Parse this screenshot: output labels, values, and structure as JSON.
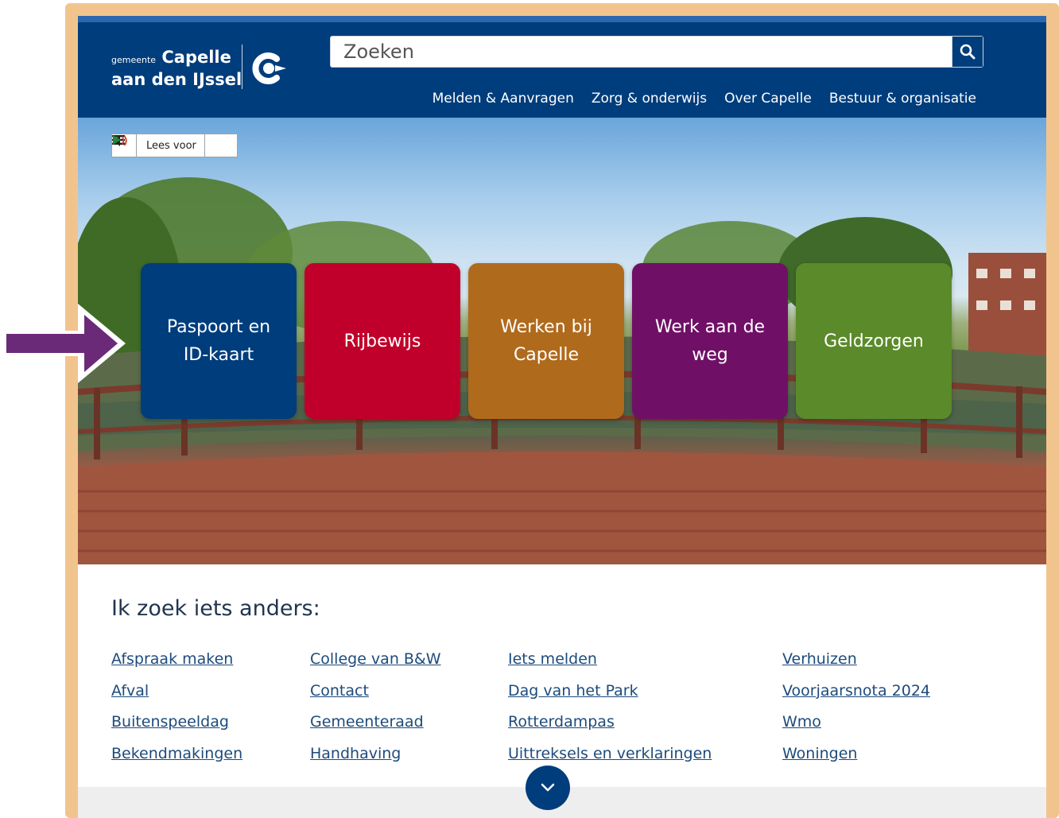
{
  "header": {
    "logo_line1_small": "gemeente",
    "logo_line1_big": "Capelle",
    "logo_line2": "aan den IJssel",
    "search_placeholder": "Zoeken",
    "nav": [
      "Melden & Aanvragen",
      "Zorg & onderwijs",
      "Over Capelle",
      "Bestuur & organisatie"
    ]
  },
  "readaloud": {
    "label": "Lees voor"
  },
  "tiles": [
    {
      "label": "Paspoort en ID-kaart",
      "color": "#003d7c"
    },
    {
      "label": "Rijbewijs",
      "color": "#c0002a"
    },
    {
      "label": "Werken bij Capelle",
      "color": "#b06a1c"
    },
    {
      "label": "Werk aan de weg",
      "color": "#6f1066"
    },
    {
      "label": "Geldzorgen",
      "color": "#5b8a2a"
    }
  ],
  "search_section": {
    "heading": "Ik zoek iets anders:",
    "columns": [
      [
        "Afspraak maken",
        "Afval",
        "Buitenspeeldag",
        "Bekendmakingen"
      ],
      [
        "College van B&W",
        "Contact",
        "Gemeenteraad",
        "Handhaving"
      ],
      [
        "Iets melden",
        "Dag van het Park",
        "Rotterdampas",
        "Uittreksels en verklaringen"
      ],
      [
        "Verhuizen",
        "Voorjaarsnota 2024",
        "Wmo",
        "Woningen"
      ]
    ]
  },
  "colors": {
    "brand_blue": "#003d7c",
    "frame": "#f2c48d",
    "arrow": "#6b2a78",
    "link": "#1d4b7c"
  },
  "icons": {
    "search": "search-icon",
    "menu": "menu-icon",
    "speaker": "speaker-icon",
    "play": "play-icon",
    "scroll": "chevron-down-icon",
    "arrow": "pointer-arrow-icon"
  }
}
